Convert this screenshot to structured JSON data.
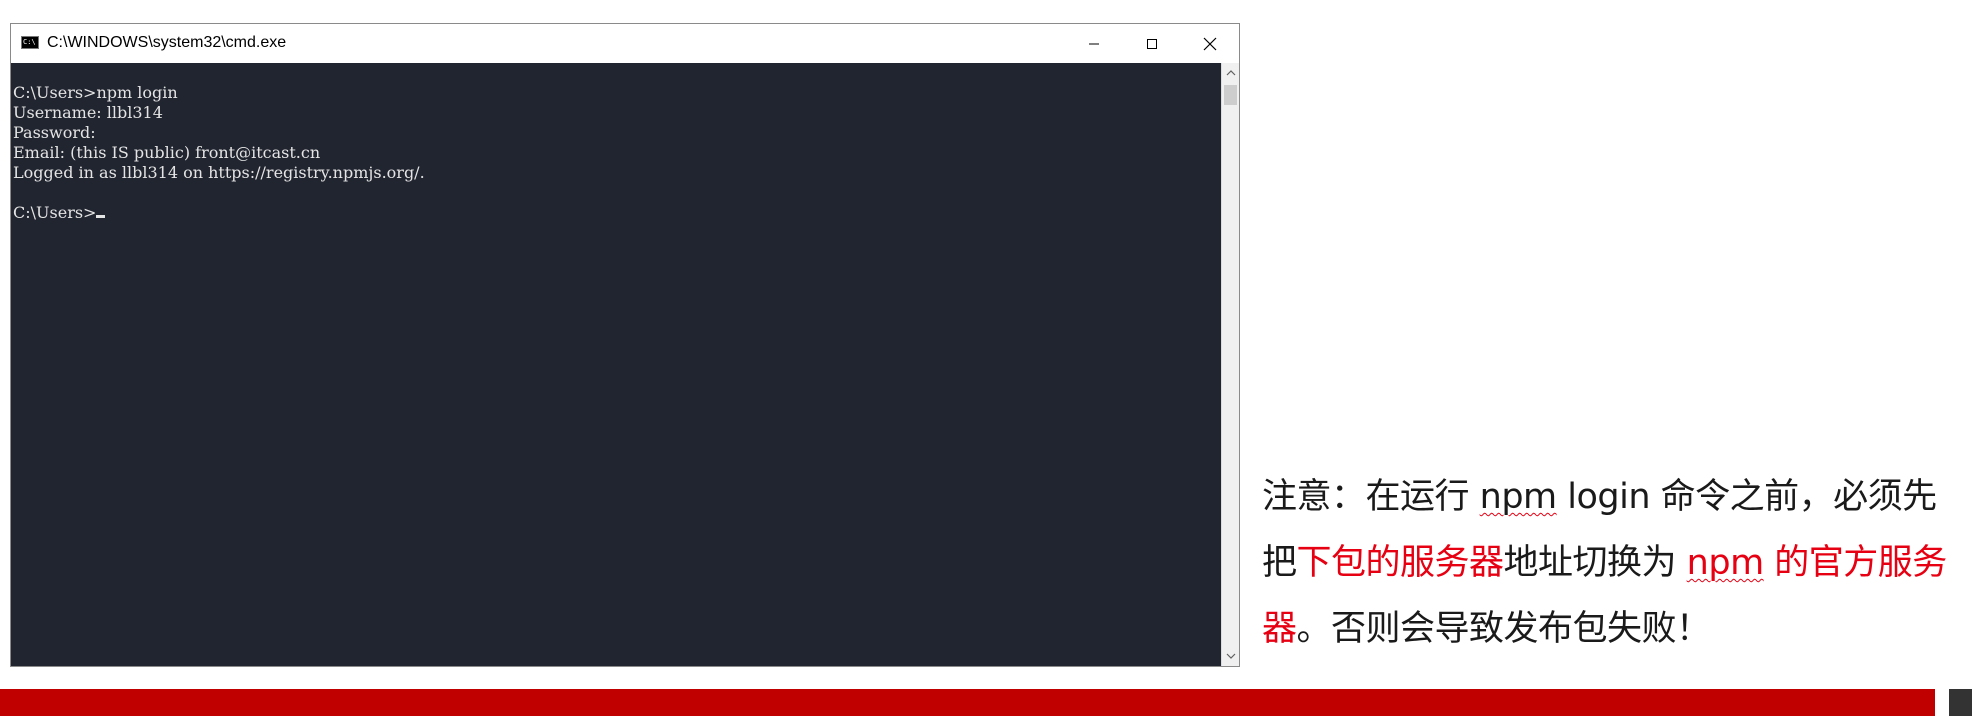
{
  "window": {
    "title": "C:\\WINDOWS\\system32\\cmd.exe",
    "icon": "cmd-app-icon",
    "icon_text": "C:\\",
    "buttons": {
      "minimize": "minimize-icon",
      "maximize": "maximize-icon",
      "close": "close-icon"
    }
  },
  "console": {
    "lines": [
      "C:\\Users>npm login",
      "Username: llbl314",
      "Password:",
      "Email: (this IS public) front@itcast.cn",
      "Logged in as llbl314 on https://registry.npmjs.org/.",
      "",
      "C:\\Users>"
    ],
    "background": "#212530",
    "foreground": "#e4e4e4"
  },
  "note": {
    "part1": "注意：在运行 ",
    "npm1": "npm",
    "part2": " login 命令之前，必须先把",
    "red1": "下包的服务器",
    "part3": "地址切换为 ",
    "npm2": "npm",
    "red2": " 的官方服务器",
    "part4": "。否则会导致发布包失败！",
    "highlight_color": "#e60012"
  },
  "footer": {
    "bar_color": "#c00000",
    "block_color": "#333333"
  }
}
